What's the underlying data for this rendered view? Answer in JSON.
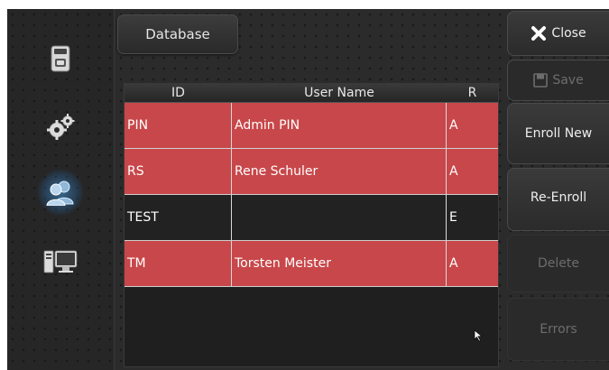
{
  "tab": {
    "title": "Database"
  },
  "table": {
    "columns": [
      "ID",
      "User Name",
      "R"
    ],
    "rows": [
      {
        "id": "PIN",
        "name": "Admin PIN",
        "role": "A",
        "highlight": true
      },
      {
        "id": "RS",
        "name": "Rene Schuler",
        "role": "A",
        "highlight": true
      },
      {
        "id": "TEST",
        "name": "",
        "role": "E",
        "highlight": false
      },
      {
        "id": "TM",
        "name": "Torsten Meister",
        "role": "A",
        "highlight": true
      }
    ]
  },
  "actions": {
    "close": "Close",
    "save": "Save",
    "enroll_new": "Enroll New",
    "re_enroll": "Re-Enroll",
    "delete": "Delete",
    "errors": "Errors"
  },
  "nav": {
    "items": [
      {
        "icon": "device-icon"
      },
      {
        "icon": "gears-icon"
      },
      {
        "icon": "users-icon",
        "active": true
      },
      {
        "icon": "computer-icon"
      }
    ]
  },
  "colors": {
    "row_highlight": "#c8474a",
    "row_normal": "#222222",
    "active_glow": "#46a0e6"
  }
}
